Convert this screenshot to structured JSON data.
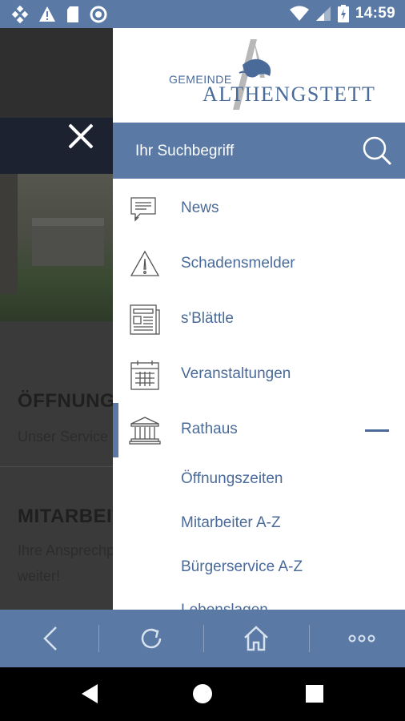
{
  "status_bar": {
    "time": "14:59",
    "icons": [
      "app-notification-icon",
      "alert-icon",
      "sd-card-icon",
      "sync-icon",
      "wifi-icon",
      "signal-icon",
      "battery-charging-icon"
    ]
  },
  "background_page": {
    "heading_1": "ÖFFNUNGSZEITEN",
    "text_1": "Unser Service",
    "heading_2": "MITARBEITER",
    "text_2a": "Ihre Ansprechpartner",
    "text_2b": "weiter!"
  },
  "logo": {
    "small_text": "GEMEINDE",
    "big_text": "ALTHENGSTETT"
  },
  "search": {
    "placeholder": "Ihr Suchbegriff"
  },
  "menu": {
    "items": [
      {
        "label": "News",
        "icon": "speech-bubbles-icon"
      },
      {
        "label": "Schadensmelder",
        "icon": "warning-triangle-icon"
      },
      {
        "label": "s'Blättle",
        "icon": "newspaper-icon"
      },
      {
        "label": "Veranstaltungen",
        "icon": "calendar-icon"
      },
      {
        "label": "Rathaus",
        "icon": "town-hall-icon"
      }
    ],
    "sub_items": [
      {
        "label": "Öffnungszeiten"
      },
      {
        "label": "Mitarbeiter A-Z"
      },
      {
        "label": "Bürgerservice A-Z"
      },
      {
        "label": "Lebenslagen"
      }
    ]
  },
  "toolbar": {
    "buttons": [
      "back-icon",
      "reload-icon",
      "home-icon",
      "more-icon"
    ]
  },
  "colors": {
    "accent": "#5a7aa5",
    "link": "#4a6b9a"
  }
}
